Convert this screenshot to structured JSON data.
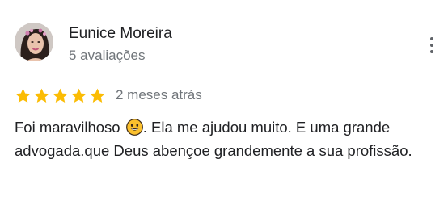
{
  "review": {
    "author": {
      "name": "Eunice Moreira",
      "meta": "5 avaliações"
    },
    "rating": {
      "stars": 5,
      "max_stars": 5,
      "date": "2 meses atrás"
    },
    "text": {
      "before_emoji": "Foi maravilhoso ",
      "after_emoji": ". Ela me ajudou muito. E uma grande advogada.que Deus abençoe grandemente a sua profissão."
    }
  },
  "colors": {
    "star": "#fbbc04",
    "name": "#202124",
    "secondary_text": "#70757a",
    "emoji_face": "#fbc02d"
  }
}
